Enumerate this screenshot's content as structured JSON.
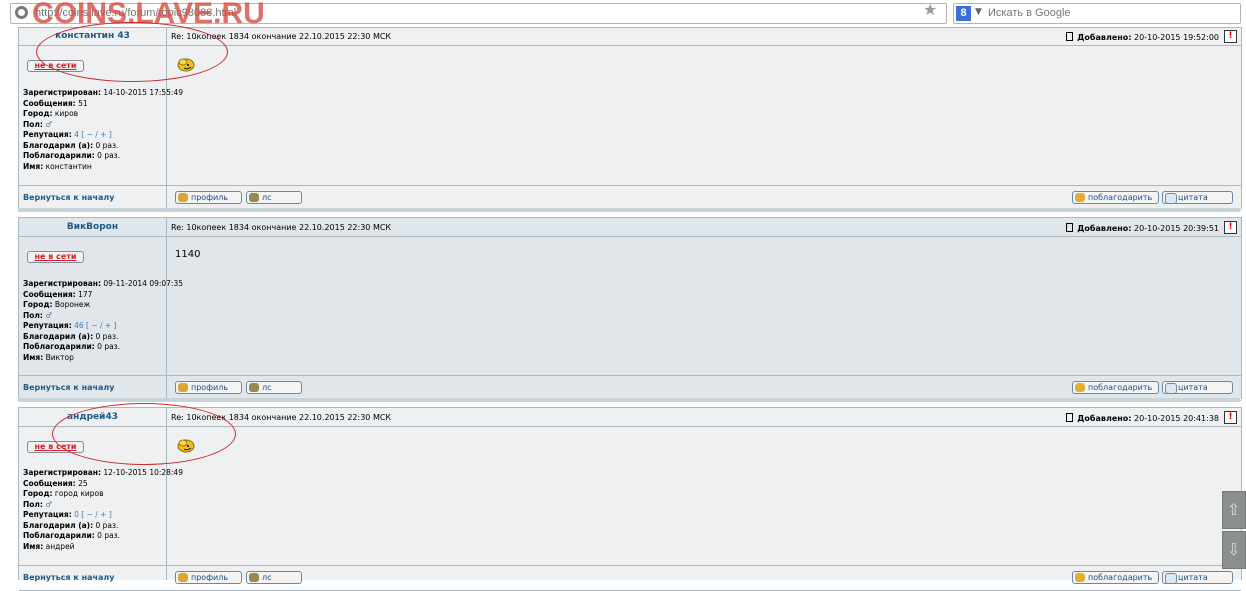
{
  "browser": {
    "url": "http://coins.lave.ru/forum/topic98088.html",
    "search_placeholder": "Искать в Google",
    "search_engine_glyph": "8",
    "star_glyph": "★"
  },
  "watermark": "COINS.LAVE.RU",
  "common": {
    "status": "не в сети",
    "back_to_top": "Вернуться к началу",
    "btn_profile": "профиль",
    "btn_pm": "лс",
    "btn_thank": "поблагодарить",
    "btn_quote": "цитата",
    "report_glyph": "!",
    "label_registered": "Зарегистрирован:",
    "label_messages": "Сообщения:",
    "label_city": "Город:",
    "label_gender": "Пол:",
    "label_reputation": "Репутация:",
    "label_thanked": "Благодарил (а):",
    "label_was_thanked": "Поблагодарили:",
    "label_name": "Имя:",
    "added_label": "Добавлено:",
    "gender_glyph": "♂",
    "rep_controls": "[ − / + ]"
  },
  "posts": [
    {
      "author": "константин 43",
      "subject": "Re: 10копеек 1834 окончание 22.10.2015 22:30 МСК",
      "added": "20-10-2015 19:52:00",
      "registered": "14-10-2015 17:55:49",
      "messages": "51",
      "city": "киров",
      "reputation": "4",
      "thanked": "0 раз.",
      "was_thanked": "0 раз.",
      "name": "константин",
      "body": "",
      "has_smiley": true
    },
    {
      "author": "ВикВорон",
      "subject": "Re: 10копеек 1834 окончание 22.10.2015 22:30 МСК",
      "added": "20-10-2015 20:39:51",
      "registered": "09-11-2014 09:07:35",
      "messages": "177",
      "city": "Воронеж",
      "reputation": "46",
      "thanked": "0 раз.",
      "was_thanked": "0 раз.",
      "name": "Виктор",
      "body": "1140",
      "has_smiley": false
    },
    {
      "author": "андрей43",
      "subject": "Re: 10копеек 1834 окончание 22.10.2015 22:30 МСК",
      "added": "20-10-2015 20:41:38",
      "registered": "12-10-2015 10:28:49",
      "messages": "25",
      "city": "город киров",
      "reputation": "0",
      "thanked": "0 раз.",
      "was_thanked": "0 раз.",
      "name": "андрей",
      "body": "",
      "has_smiley": true
    }
  ],
  "scroll": {
    "up_glyph": "⇧",
    "down_glyph": "⇩"
  },
  "colors": {
    "post_bg_1": "#eef0f1",
    "post_bg_2": "#e1e6ea",
    "link_blue": "#1c5a8a",
    "offline_red": "#d0202c",
    "annotation_red": "#c92a2a"
  }
}
